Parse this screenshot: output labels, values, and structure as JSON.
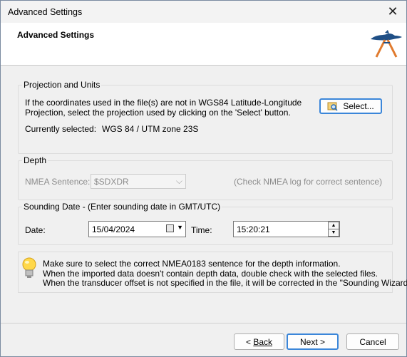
{
  "window": {
    "title": "Advanced Settings",
    "close_icon": "close-icon"
  },
  "header": {
    "title": "Advanced Settings",
    "logo_icon": "boat-anchor-logo"
  },
  "projection": {
    "group_label": "Projection and Units",
    "description_line1": "If the coordinates used in the file(s) are not in WGS84 Latitude-Longitude",
    "description_line2": "Projection, select the projection used by clicking on the 'Select' button.",
    "current_label": "Currently selected:",
    "current_value": "WGS 84 / UTM zone 23S",
    "select_button": "Select..."
  },
  "depth": {
    "group_label": "Depth",
    "nmea_label": "NMEA Sentence:",
    "nmea_value": "$SDXDR",
    "hint": "(Check NMEA log for correct sentence)"
  },
  "sounding": {
    "group_label": "Sounding Date - (Enter sounding date in GMT/UTC)",
    "date_label": "Date:",
    "date_value": "15/04/2024",
    "time_label": "Time:",
    "time_value": "15:20:21"
  },
  "tip": {
    "line1": "Make sure to select the correct NMEA0183 sentence for the depth information.",
    "line2": "When the imported data doesn't contain depth data, double check with the selected files.",
    "line3": "When the transducer offset is not specified in the file, it will be corrected in the \"Sounding Wizard\"."
  },
  "footer": {
    "back_prefix": "< ",
    "back_label": "Back",
    "next_label": "Next >",
    "cancel_label": "Cancel"
  }
}
